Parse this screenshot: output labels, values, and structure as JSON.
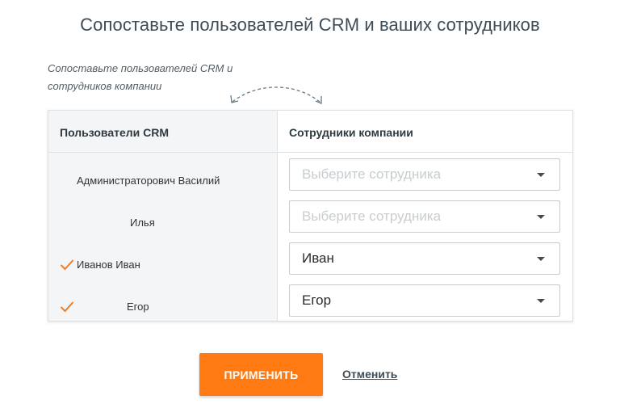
{
  "page": {
    "title": "Сопоставьте пользователей CRM и ваших сотрудников",
    "hint_line1": "Сопоставьте пользователей CRM и",
    "hint_line2": "сотрудников компании"
  },
  "table": {
    "left_header": "Пользователи CRM",
    "right_header": "Сотрудники компании",
    "rows": [
      {
        "user": "Администраторович Василий",
        "matched": false,
        "employee": "Выберите сотрудника",
        "employee_is_placeholder": true
      },
      {
        "user": "Илья",
        "matched": false,
        "employee": "Выберите сотрудника",
        "employee_is_placeholder": true
      },
      {
        "user": "Иванов Иван",
        "matched": true,
        "employee": "Иван",
        "employee_is_placeholder": false
      },
      {
        "user": "Егор",
        "matched": true,
        "employee": "Егор",
        "employee_is_placeholder": false
      }
    ]
  },
  "actions": {
    "apply_label": "ПРИМЕНИТЬ",
    "cancel_label": "Отменить"
  },
  "colors": {
    "accent": "#ff7a12",
    "check": "#f57c1f",
    "title": "#3d4c56"
  },
  "icons": {
    "arrows": "swap-arrows-icon",
    "check": "checkmark-icon",
    "caret": "chevron-down-icon"
  }
}
